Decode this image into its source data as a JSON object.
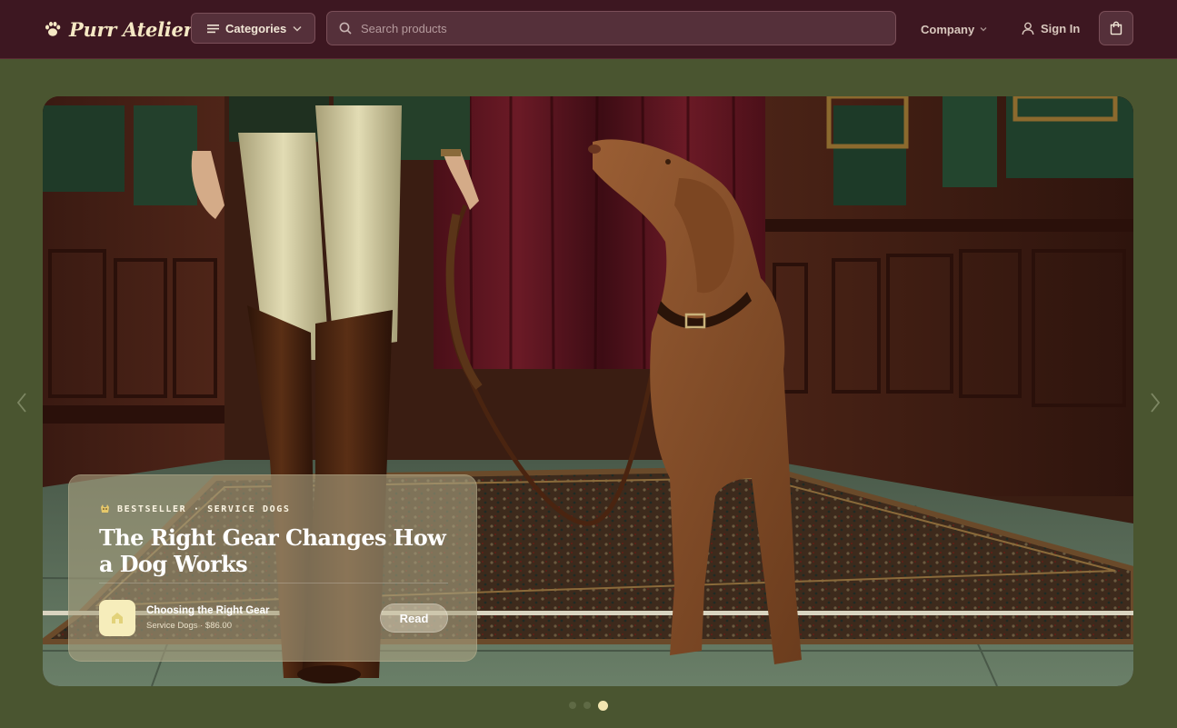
{
  "brand": {
    "name": "Purr Atelier",
    "icon": "paw-icon"
  },
  "nav": {
    "categories_label": "Categories",
    "search_placeholder": "Search products",
    "company_label": "Company",
    "signin_label": "Sign In",
    "cart_icon": "shopping-bag-icon"
  },
  "hero": {
    "badge_icon": "dog-icon",
    "tagline": "BESTSELLER · SERVICE DOGS",
    "title": "The Right Gear Changes How a Dog Works",
    "product": {
      "name": "Choosing the Right Gear",
      "meta": "Service Dogs · $86.00",
      "icon": "house-icon"
    },
    "read_label": "Read"
  },
  "carousel": {
    "slide_count": 3,
    "active_index": 2
  },
  "colors": {
    "header_bg": "#3d1721",
    "page_bg": "#4a5530",
    "accent_cream": "#f2e6b0"
  }
}
